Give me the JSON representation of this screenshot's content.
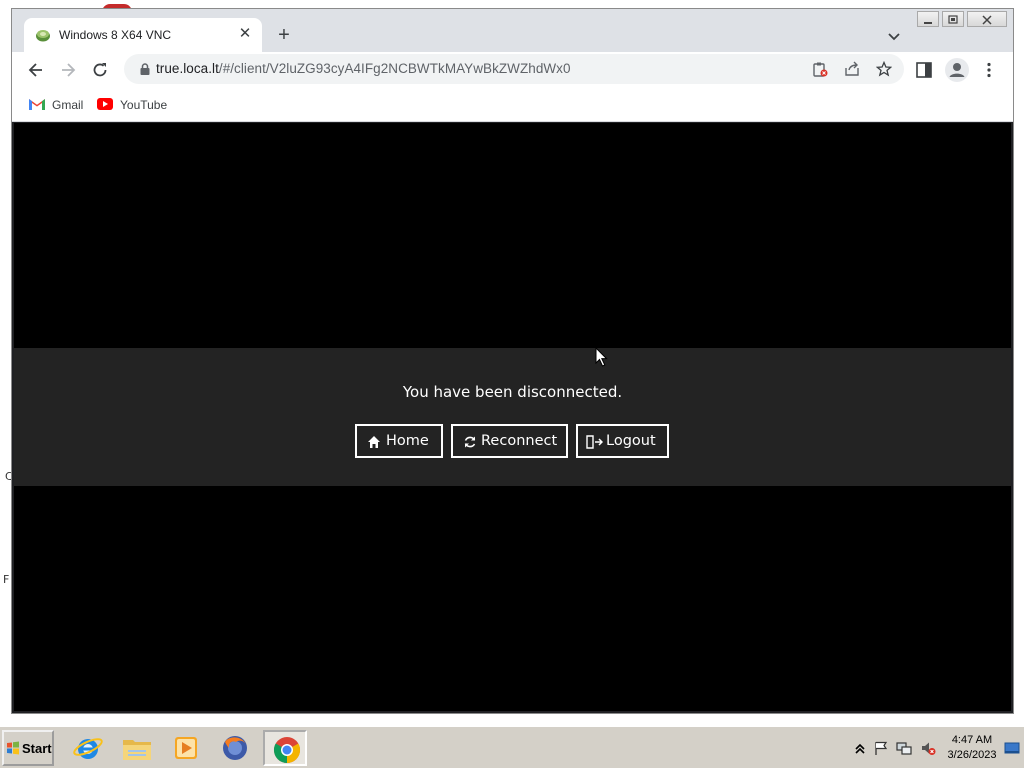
{
  "desktop": {
    "edge_labels": [
      "C",
      "F"
    ]
  },
  "browser": {
    "tab": {
      "title": "Windows 8 X64 VNC",
      "close_glyph": "✕"
    },
    "new_tab_glyph": "+",
    "omnibox": {
      "host": "true.loca.lt",
      "path": "/#/client/V2luZG93cyA4IFg2NCBWTkMAYwBkZWZhdWx0"
    },
    "bookmarks": [
      {
        "label": "Gmail",
        "icon": "gmail-icon"
      },
      {
        "label": "YouTube",
        "icon": "youtube-icon"
      }
    ]
  },
  "guacamole": {
    "message": "You have been disconnected.",
    "buttons": {
      "home": "Home",
      "reconnect": "Reconnect",
      "logout": "Logout"
    }
  },
  "taskbar": {
    "start_label": "Start",
    "apps": [
      "internet-explorer-icon",
      "file-explorer-icon",
      "media-player-icon",
      "firefox-icon",
      "chrome-icon"
    ],
    "clock": {
      "time": "4:47 AM",
      "date": "3/26/2023"
    }
  },
  "colors": {
    "viewport_bg": "#000000",
    "dialog_bg": "#232323",
    "chrome_frame": "#dee1e6",
    "taskbar_bg": "#d4d0c8"
  }
}
